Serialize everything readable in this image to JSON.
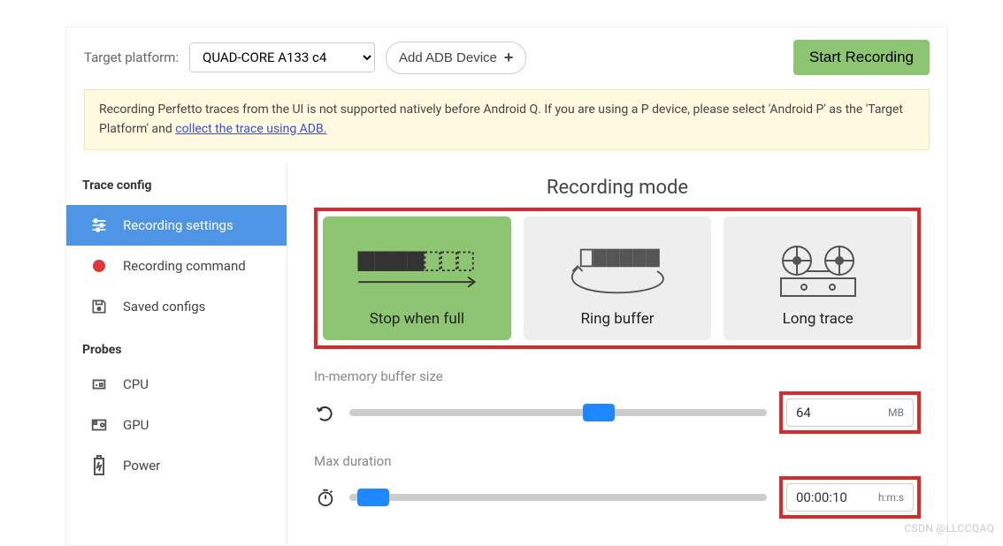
{
  "topbar": {
    "target_label": "Target platform:",
    "selected_device": "QUAD-CORE A133 c4",
    "add_device_label": "Add ADB Device",
    "start_label": "Start Recording"
  },
  "notice": {
    "text_a": "Recording Perfetto traces from the UI is not supported natively before Android Q. If you are using a P device, please select 'Android P' as the 'Target Platform' and ",
    "link_text": "collect the trace using ADB.",
    "text_b": ""
  },
  "sidebar": {
    "section1_title": "Trace config",
    "section2_title": "Probes",
    "items_a": [
      {
        "label": "Recording settings"
      },
      {
        "label": "Recording command"
      },
      {
        "label": "Saved configs"
      }
    ],
    "items_b": [
      {
        "label": "CPU"
      },
      {
        "label": "GPU"
      },
      {
        "label": "Power"
      }
    ]
  },
  "main": {
    "recording_mode_title": "Recording mode",
    "modes": [
      {
        "label": "Stop when full"
      },
      {
        "label": "Ring buffer"
      },
      {
        "label": "Long trace"
      }
    ],
    "buf_label": "In-memory buffer size",
    "buf_value": "64",
    "buf_unit": "MB",
    "dur_label": "Max duration",
    "dur_value": "00:00:10",
    "dur_unit": "h:m:s"
  },
  "watermark": "CSDN @LLCCQAQ"
}
